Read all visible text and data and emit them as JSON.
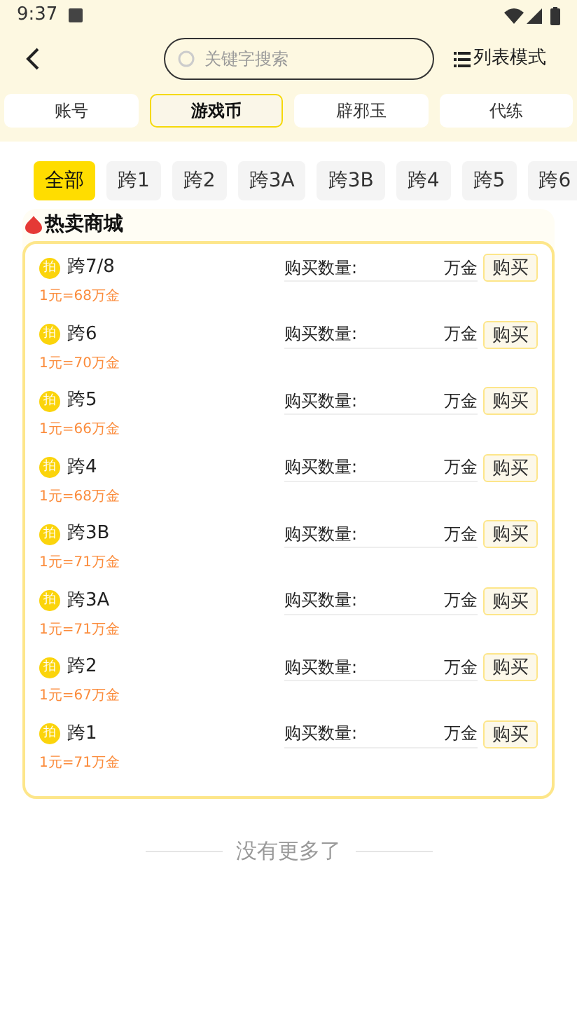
{
  "status_bar": {
    "time": "9:37"
  },
  "header": {
    "search": {
      "placeholder": "关键字搜索"
    },
    "mode_button": "列表模式"
  },
  "tabs": [
    {
      "label": "账号",
      "selected": false
    },
    {
      "label": "游戏币",
      "selected": true
    },
    {
      "label": "辟邪玉",
      "selected": false
    },
    {
      "label": "代练",
      "selected": false
    }
  ],
  "filters": [
    {
      "label": "全部",
      "selected": true
    },
    {
      "label": "跨1",
      "selected": false
    },
    {
      "label": "跨2",
      "selected": false
    },
    {
      "label": "跨3A",
      "selected": false
    },
    {
      "label": "跨3B",
      "selected": false
    },
    {
      "label": "跨4",
      "selected": false
    },
    {
      "label": "跨5",
      "selected": false
    },
    {
      "label": "跨6",
      "selected": false
    }
  ],
  "section_title": "热卖商城",
  "items": [
    {
      "badge": "拍",
      "name": "跨7/8",
      "rate": "1元=68万金",
      "quantity_label": "购买数量:",
      "unit": "万金",
      "buy": "购买"
    },
    {
      "badge": "拍",
      "name": "跨6",
      "rate": "1元=70万金",
      "quantity_label": "购买数量:",
      "unit": "万金",
      "buy": "购买"
    },
    {
      "badge": "拍",
      "name": "跨5",
      "rate": "1元=66万金",
      "quantity_label": "购买数量:",
      "unit": "万金",
      "buy": "购买"
    },
    {
      "badge": "拍",
      "name": "跨4",
      "rate": "1元=68万金",
      "quantity_label": "购买数量:",
      "unit": "万金",
      "buy": "购买"
    },
    {
      "badge": "拍",
      "name": "跨3B",
      "rate": "1元=71万金",
      "quantity_label": "购买数量:",
      "unit": "万金",
      "buy": "购买"
    },
    {
      "badge": "拍",
      "name": "跨3A",
      "rate": "1元=71万金",
      "quantity_label": "购买数量:",
      "unit": "万金",
      "buy": "购买"
    },
    {
      "badge": "拍",
      "name": "跨2",
      "rate": "1元=67万金",
      "quantity_label": "购买数量:",
      "unit": "万金",
      "buy": "购买"
    },
    {
      "badge": "拍",
      "name": "跨1",
      "rate": "1元=71万金",
      "quantity_label": "购买数量:",
      "unit": "万金",
      "buy": "购买"
    }
  ],
  "footer": "没有更多了"
}
